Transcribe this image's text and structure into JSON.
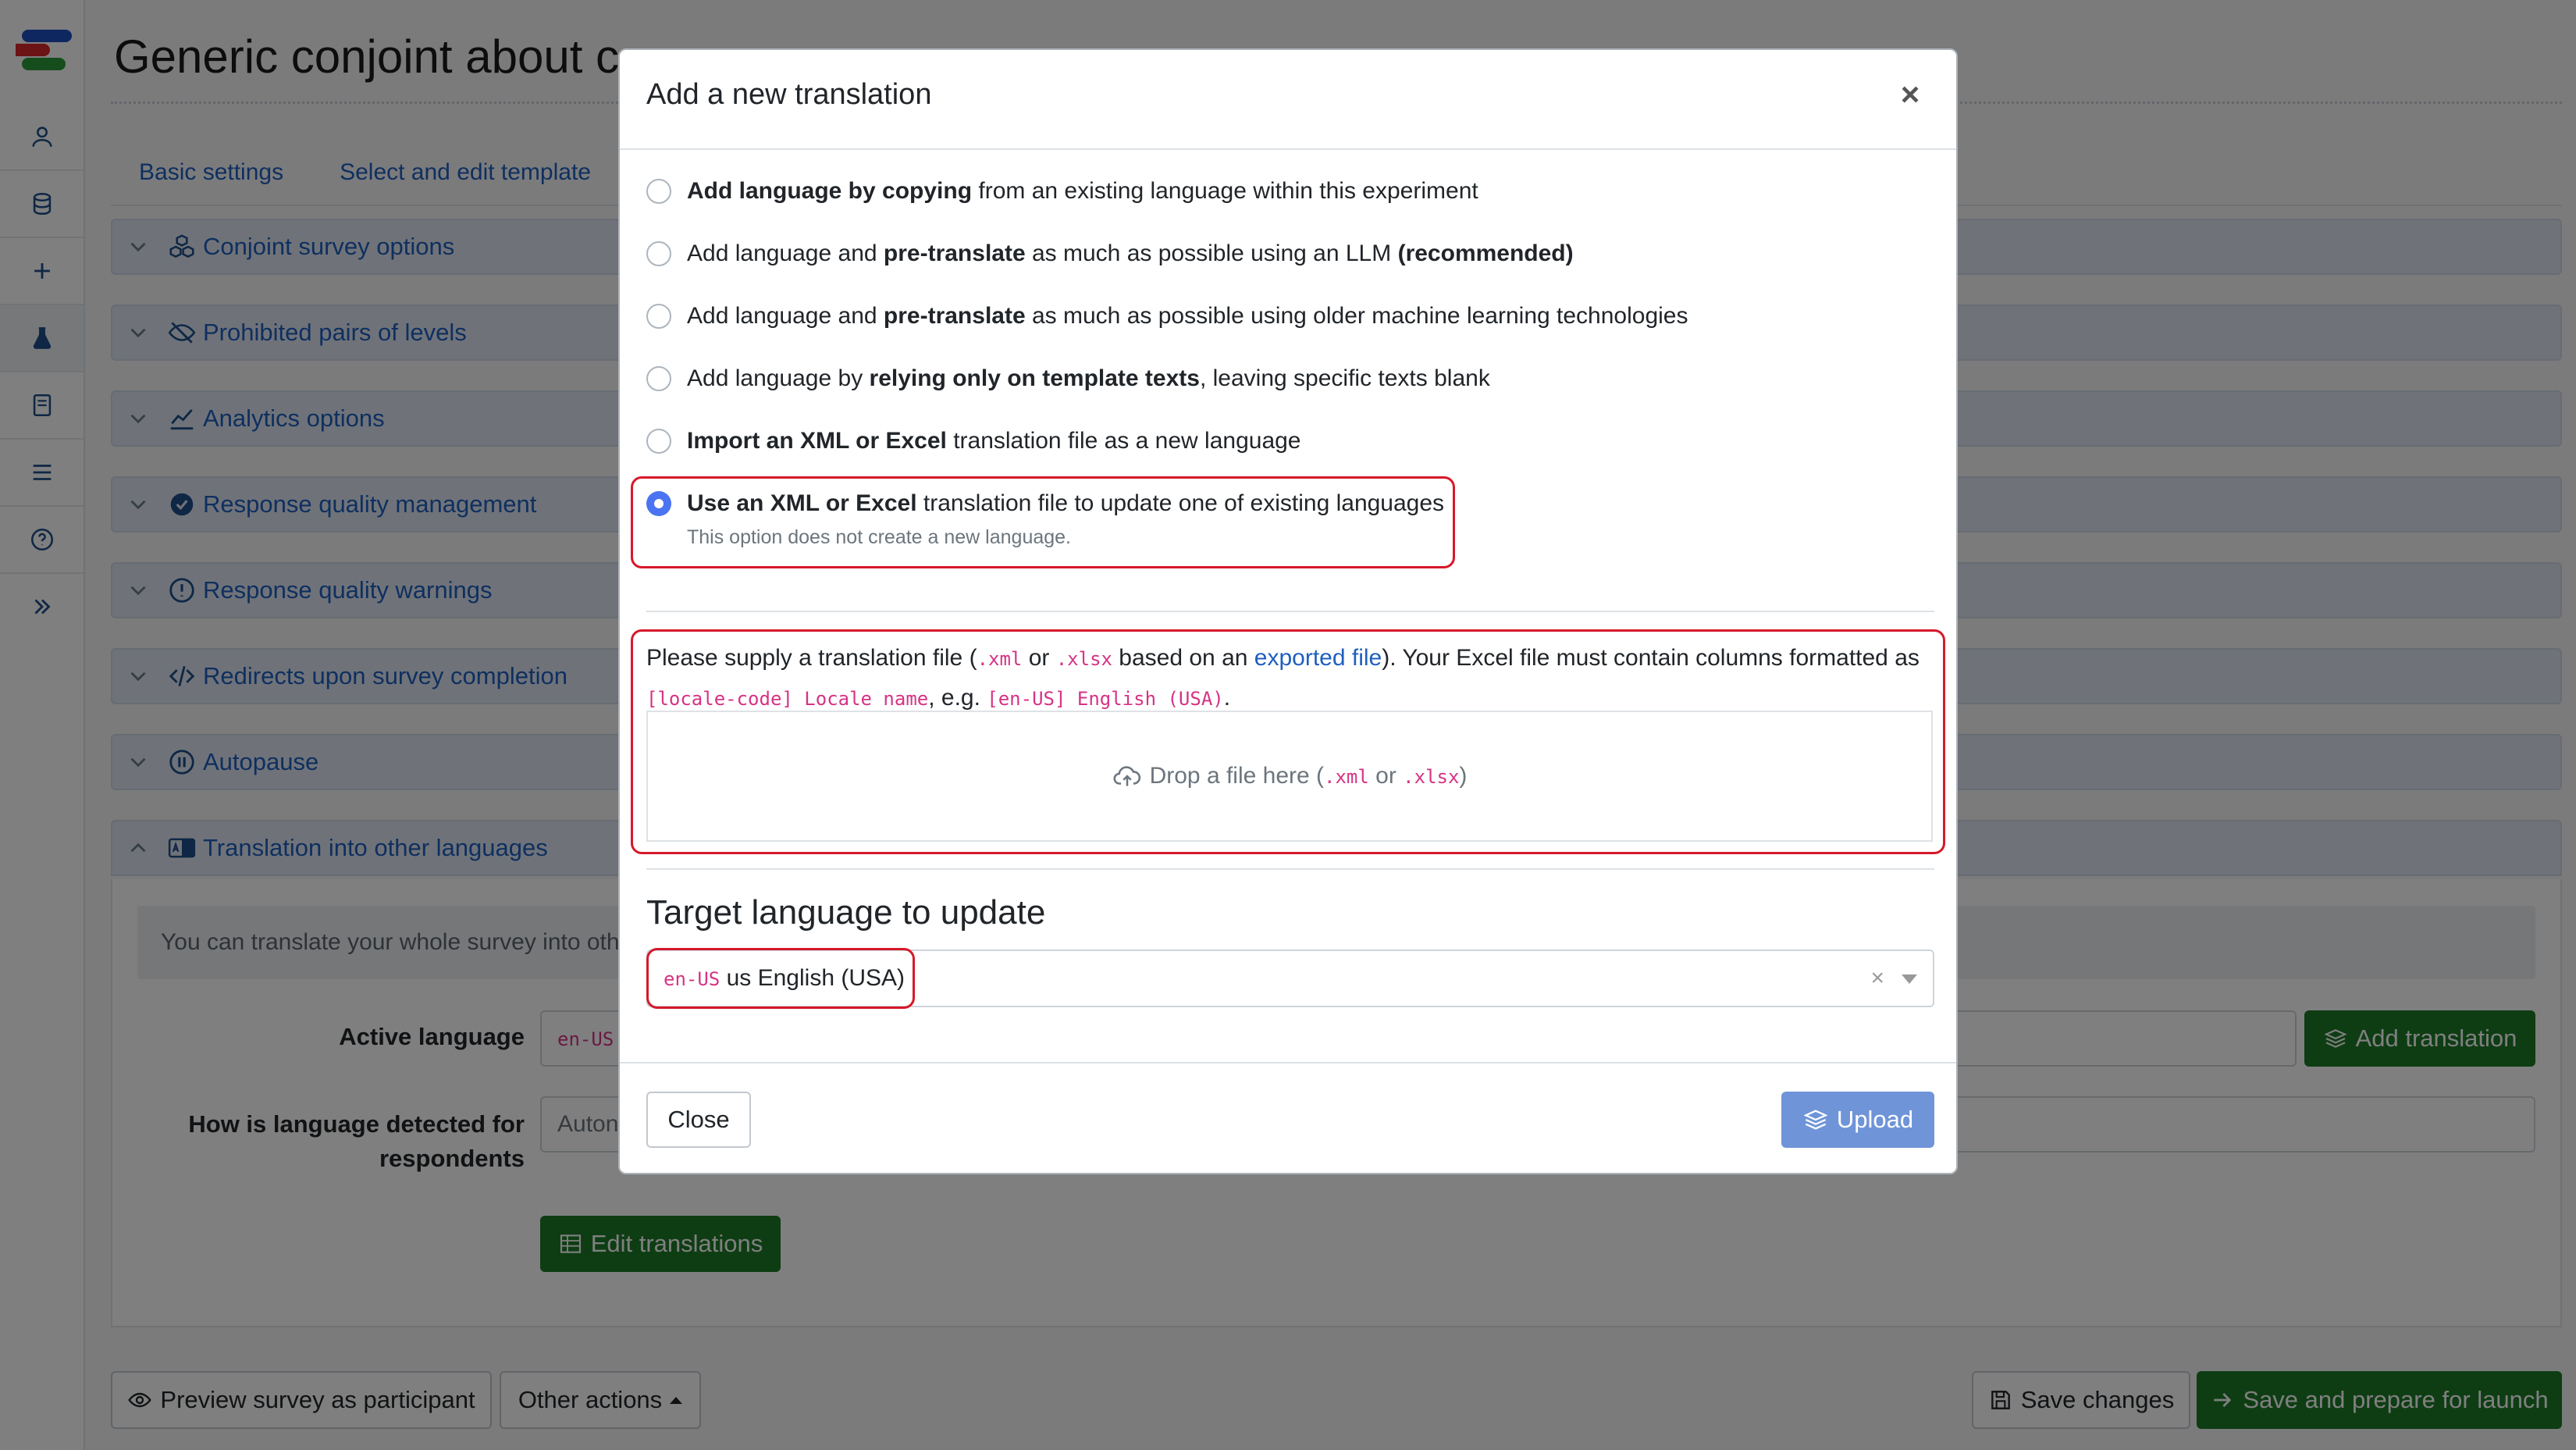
{
  "app": {
    "title": "Generic conjoint about c",
    "tabs": [
      "Basic settings",
      "Select and edit template"
    ]
  },
  "sidebar": {
    "icons": [
      "user-icon",
      "database-icon",
      "plus-icon",
      "flask-icon",
      "book-icon",
      "list-icon",
      "help-icon",
      "expand-icon"
    ],
    "active_index": 3
  },
  "accordion": [
    {
      "label": "Conjoint survey options",
      "icon": "cubes-icon"
    },
    {
      "label": "Prohibited pairs of levels",
      "icon": "eye-slash-icon"
    },
    {
      "label": "Analytics options",
      "icon": "chart-line-icon"
    },
    {
      "label": "Response quality management",
      "icon": "check-circle-icon"
    },
    {
      "label": "Response quality warnings",
      "icon": "exclamation-circle-icon"
    },
    {
      "label": "Redirects upon survey completion",
      "icon": "code-icon"
    },
    {
      "label": "Autopause",
      "icon": "pause-circle-icon"
    },
    {
      "label": "Translation into other languages",
      "icon": "language-icon"
    }
  ],
  "translation_panel": {
    "info_text": "You can translate your whole survey into oth",
    "active_language_label": "Active language",
    "active_language_code": "en-US",
    "detection_label_line1": "How is language detected for",
    "detection_label_line2": "respondents",
    "detection_value": "Auton",
    "add_translation": "Add translation",
    "edit_translations": "Edit translations"
  },
  "footer": {
    "preview": "Preview survey as participant",
    "other_actions": "Other actions",
    "save": "Save changes",
    "save_launch": "Save and prepare for launch"
  },
  "modal": {
    "title": "Add a new translation",
    "close_symbol": "×",
    "options": [
      {
        "bold": "Add language by copying",
        "rest": " from an existing language within this experiment",
        "selected": false
      },
      {
        "pre": "Add language and ",
        "bold": "pre-translate",
        "rest": " as much as possible using an LLM ",
        "bold2": "(recommended)",
        "selected": false
      },
      {
        "pre": "Add language and ",
        "bold": "pre-translate",
        "rest": " as much as possible using older machine learning technologies",
        "selected": false
      },
      {
        "pre": "Add language by ",
        "bold": "relying only on template texts",
        "rest": ", leaving specific texts blank",
        "selected": false
      },
      {
        "bold": "Import an XML or Excel",
        "rest": " translation file as a new language",
        "selected": false
      },
      {
        "bold": "Use an XML or Excel",
        "rest": " translation file to update one of existing languages",
        "selected": true
      }
    ],
    "option_hint": "This option does not create a new language.",
    "supply": {
      "t1": "Please supply a translation file (",
      "ext_xml": ".xml",
      "t2": " or ",
      "ext_xlsx": ".xlsx",
      "t3": " based on an ",
      "link": "exported file",
      "t4": "). Your Excel file must contain columns formatted as ",
      "format_code": "[locale-code] Locale name",
      "t5": ", e.g. ",
      "example_code": "[en-US] English (USA)",
      "t6": "."
    },
    "dropzone": {
      "t1": "Drop a file here (",
      "ext_xml": ".xml",
      "t2": " or ",
      "ext_xlsx": ".xlsx",
      "t3": ")"
    },
    "target_heading": "Target language to update",
    "target_code": "en-US",
    "target_name": " us English (USA)",
    "clear_symbol": "×",
    "close_button": "Close",
    "upload_button": "Upload"
  },
  "colors": {
    "accent": "#1f5fbf",
    "green": "#1d7a26",
    "highlight": "#d6192a",
    "radio": "#4a74f2",
    "upload": "#6f94d8"
  }
}
